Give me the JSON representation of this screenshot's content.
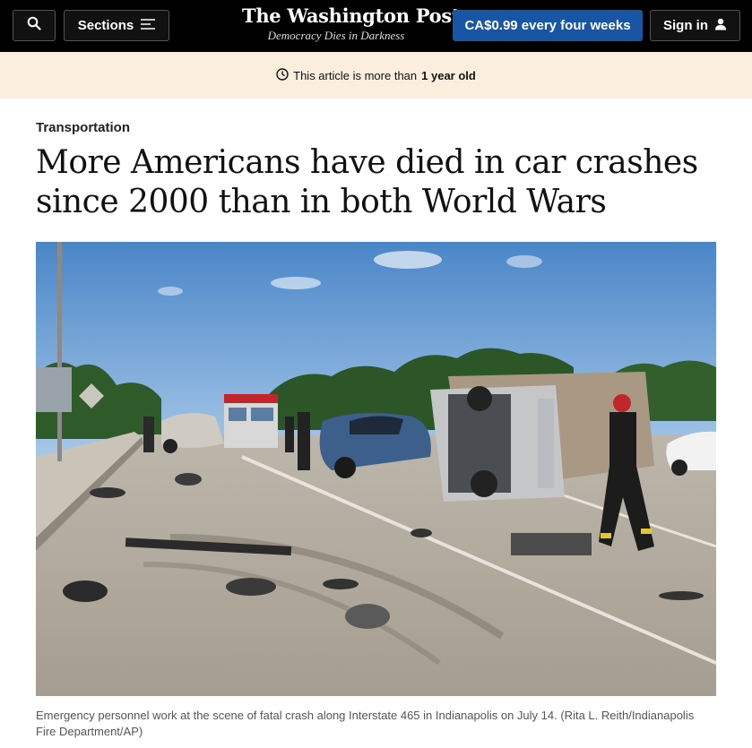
{
  "header": {
    "search_icon": "search-icon",
    "sections_label": "Sections",
    "menu_icon": "menu-icon",
    "logo": "The Washington Post",
    "tagline": "Democracy Dies in Darkness",
    "subscribe_label": "CA$0.99 every four weeks",
    "signin_label": "Sign in",
    "user_icon": "user-icon"
  },
  "notice": {
    "clock_icon": "clock-icon",
    "prefix": "This article is more than",
    "emphasis": "1 year old"
  },
  "article": {
    "kicker": "Transportation",
    "headline": "More Americans have died in car crashes since 2000 than in both World Wars",
    "photo_caption": "Emergency personnel work at the scene of fatal crash along Interstate 465 in Indianapolis on July 14. (Rita L. Reith/Indianapolis Fire Department/AP)"
  },
  "colors": {
    "header_bg": "#000000",
    "subscribe_bg": "#1955a5",
    "notice_bg": "#fbeedd"
  }
}
